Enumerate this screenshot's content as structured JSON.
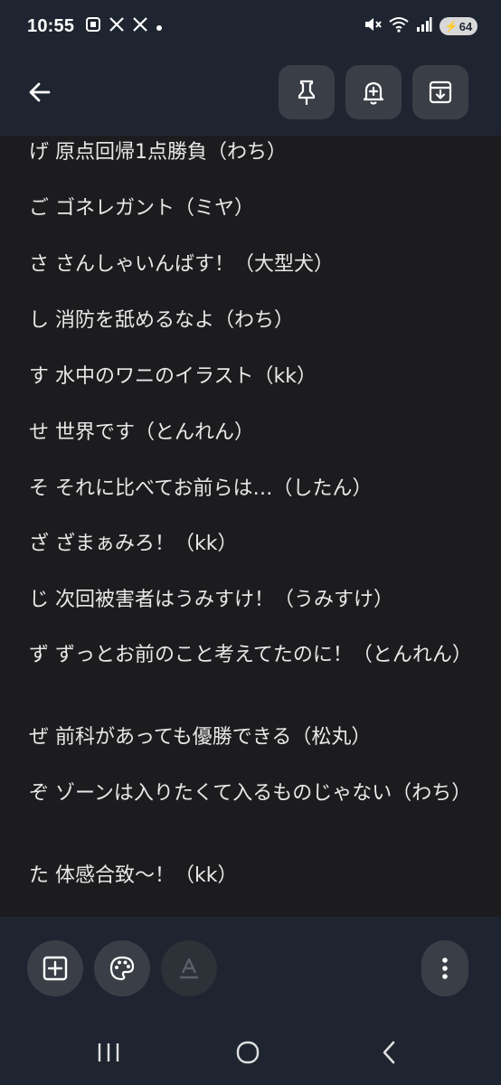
{
  "status_bar": {
    "time": "10:55",
    "left_icons": [
      "screenshot-icon",
      "x-logo-icon",
      "x-logo-icon",
      "dot-icon"
    ],
    "right_icons": [
      "mute-icon",
      "wifi-icon",
      "signal-icon"
    ],
    "battery_level": "64"
  },
  "toolbar": {
    "buttons": [
      "back-arrow-icon",
      "pin-icon",
      "reminder-bell-icon",
      "archive-icon"
    ]
  },
  "note": {
    "lines": [
      "げ 原点回帰1点勝負（わち）",
      "ご ゴネレガント（ミヤ）",
      "さ さんしゃいんばす！（大型犬）",
      "し 消防を舐めるなよ（わち）",
      "す 水中のワニのイラスト（kk）",
      "せ 世界です（とんれん）",
      "そ それに比べてお前らは…（したん）",
      "ざ ざまぁみろ！（kk）",
      "じ 次回被害者はうみすけ！（うみすけ）",
      "ず ずっとお前のこと考えてたのに！（とんれん）",
      "ぜ 前科があっても優勝できる（松丸）",
      "ぞ ゾーンは入りたくて入るものじゃない（わち）",
      "た 体感合致〜！（kk）"
    ]
  },
  "bottom_bar": {
    "buttons": [
      "add-box-icon",
      "palette-icon",
      "text-format-icon",
      "more-vert-icon"
    ]
  },
  "nav_bar": {
    "buttons": [
      "recent-apps-icon",
      "home-icon",
      "nav-back-icon"
    ]
  },
  "colors": {
    "background": "#1c1c1e",
    "bar": "#1f2530",
    "button": "#3a3f47",
    "text": "#e8e8e8"
  }
}
